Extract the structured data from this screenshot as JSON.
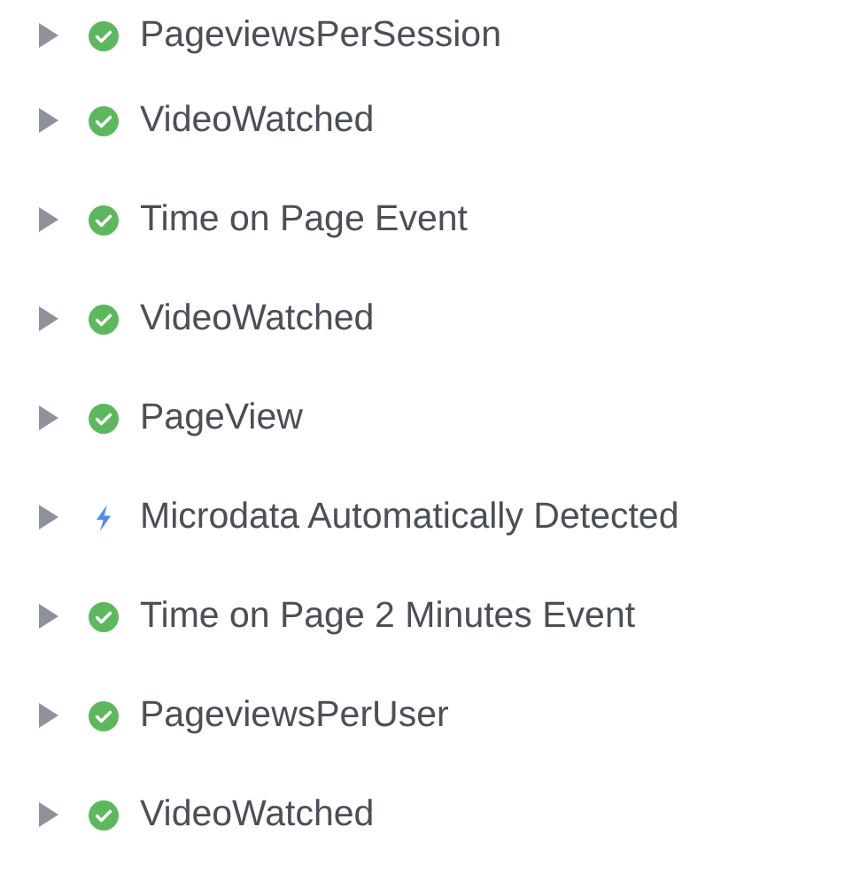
{
  "events": [
    {
      "label": "PageviewsPerSession",
      "kind": "success",
      "expanded": false
    },
    {
      "label": "VideoWatched",
      "kind": "success",
      "expanded": false
    },
    {
      "label": "Time on Page Event",
      "kind": "success",
      "expanded": false
    },
    {
      "label": "VideoWatched",
      "kind": "success",
      "expanded": false
    },
    {
      "label": "PageView",
      "kind": "success",
      "expanded": false
    },
    {
      "label": "Microdata Automatically Detected",
      "kind": "automatic",
      "expanded": false
    },
    {
      "label": "Time on Page 2 Minutes Event",
      "kind": "success",
      "expanded": false
    },
    {
      "label": "PageviewsPerUser",
      "kind": "success",
      "expanded": false
    },
    {
      "label": "VideoWatched",
      "kind": "success",
      "expanded": false
    }
  ]
}
